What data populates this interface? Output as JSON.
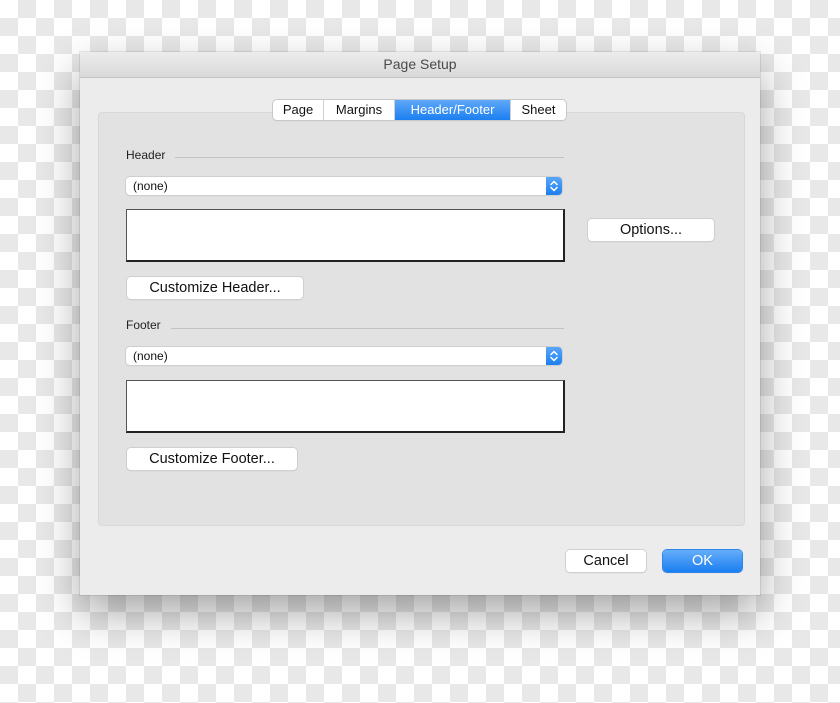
{
  "dialog": {
    "title": "Page Setup",
    "tabs": [
      {
        "label": "Page",
        "active": false
      },
      {
        "label": "Margins",
        "active": false
      },
      {
        "label": "Header/Footer",
        "active": true
      },
      {
        "label": "Sheet",
        "active": false
      }
    ],
    "header": {
      "label": "Header",
      "select_value": "(none)",
      "preview_text": "",
      "customize_label": "Customize Header..."
    },
    "footer": {
      "label": "Footer",
      "select_value": "(none)",
      "preview_text": "",
      "customize_label": "Customize Footer..."
    },
    "options_label": "Options...",
    "cancel_label": "Cancel",
    "ok_label": "OK"
  },
  "icons": {
    "stepper": "up-down-chevron-icon"
  },
  "colors": {
    "accent": "#1b7ff0",
    "dialog_bg": "#ececec",
    "panel_bg": "#e2e2e2"
  }
}
